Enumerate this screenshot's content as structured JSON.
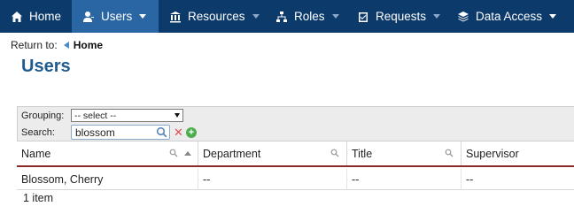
{
  "nav": {
    "items": [
      {
        "label": "Home",
        "icon": "home-icon"
      },
      {
        "label": "Users",
        "icon": "users-icon"
      },
      {
        "label": "Resources",
        "icon": "bank-icon"
      },
      {
        "label": "Roles",
        "icon": "hierarchy-icon"
      },
      {
        "label": "Requests",
        "icon": "checklist-icon"
      },
      {
        "label": "Data Access",
        "icon": "layers-icon"
      }
    ],
    "active": "Users",
    "colors": {
      "bar": "#0b3a6b",
      "active": "#2a66a3"
    }
  },
  "breadcrumb": {
    "prefix": "Return to:",
    "link": "Home"
  },
  "page": {
    "title": "Users"
  },
  "toolbar": {
    "grouping_label": "Grouping:",
    "grouping_value": "-- select --",
    "search_label": "Search:",
    "search_value": "blossom"
  },
  "table": {
    "columns": [
      "Name",
      "Department",
      "Title",
      "Supervisor"
    ],
    "rows": [
      [
        "Blossom, Cherry",
        "--",
        "--",
        "--"
      ]
    ],
    "count_text": "1 item"
  }
}
